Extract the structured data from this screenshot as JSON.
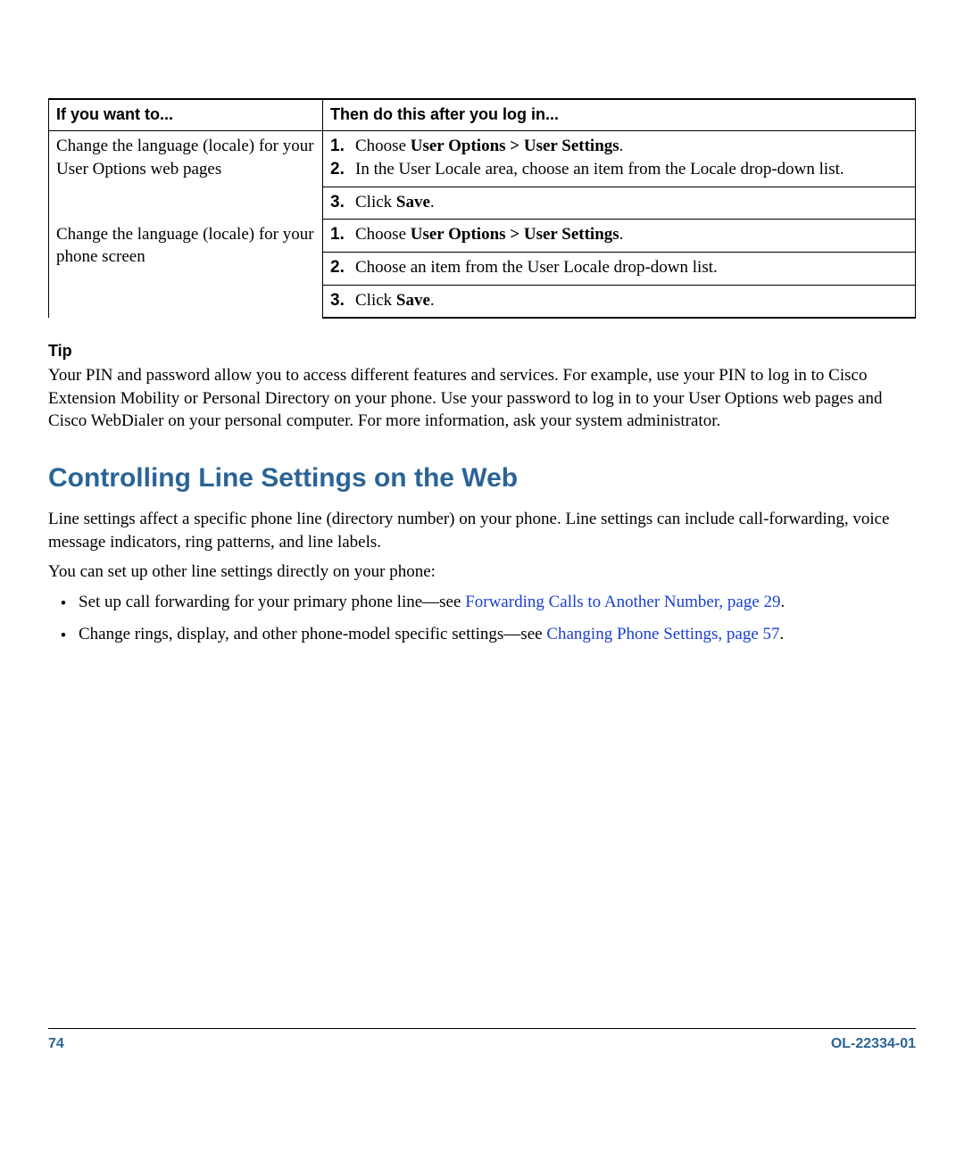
{
  "table": {
    "header_left": "If you want to...",
    "header_right": "Then do this after you log in...",
    "rows": [
      {
        "left": "Change the language (locale) for your User Options web pages",
        "steps": [
          {
            "num": "1.",
            "pre": "Choose ",
            "bold": "User Options > User Settings",
            "post": "."
          },
          {
            "num": "2.",
            "pre": "In the User Locale area, choose an item from the Locale drop-down list.",
            "bold": "",
            "post": ""
          },
          {
            "num": "3.",
            "pre": "Click ",
            "bold": "Save",
            "post": "."
          }
        ]
      },
      {
        "left": "Change the language (locale) for your phone screen",
        "steps": [
          {
            "num": "1.",
            "pre": "Choose ",
            "bold": "User Options > User Settings",
            "post": "."
          },
          {
            "num": "2.",
            "pre": "Choose an item from the User Locale drop-down list.",
            "bold": "",
            "post": ""
          },
          {
            "num": "3.",
            "pre": "Click ",
            "bold": "Save",
            "post": "."
          }
        ]
      }
    ]
  },
  "tip": {
    "label": "Tip",
    "body": "Your PIN and password allow you to access different features and services. For example, use your PIN to log in to Cisco Extension Mobility or Personal Directory on your phone. Use your password to log in to your User Options web pages and Cisco WebDialer on your personal computer. For more information, ask your system administrator."
  },
  "heading": "Controlling Line Settings on the Web",
  "para1": "Line settings affect a specific phone line (directory number) on your phone. Line settings can include call-forwarding, voice message indicators, ring patterns, and line labels.",
  "para2": "You can set up other line settings directly on your phone:",
  "bullets": [
    {
      "pre": "Set up call forwarding for your primary phone line—see ",
      "link": "Forwarding Calls to Another Number, page 29",
      "post": "."
    },
    {
      "pre": "Change rings, display, and other phone-model specific settings—see ",
      "link": "Changing Phone Settings, page 57",
      "post": "."
    }
  ],
  "footer": {
    "page_num": "74",
    "doc_id": "OL-22334-01"
  }
}
